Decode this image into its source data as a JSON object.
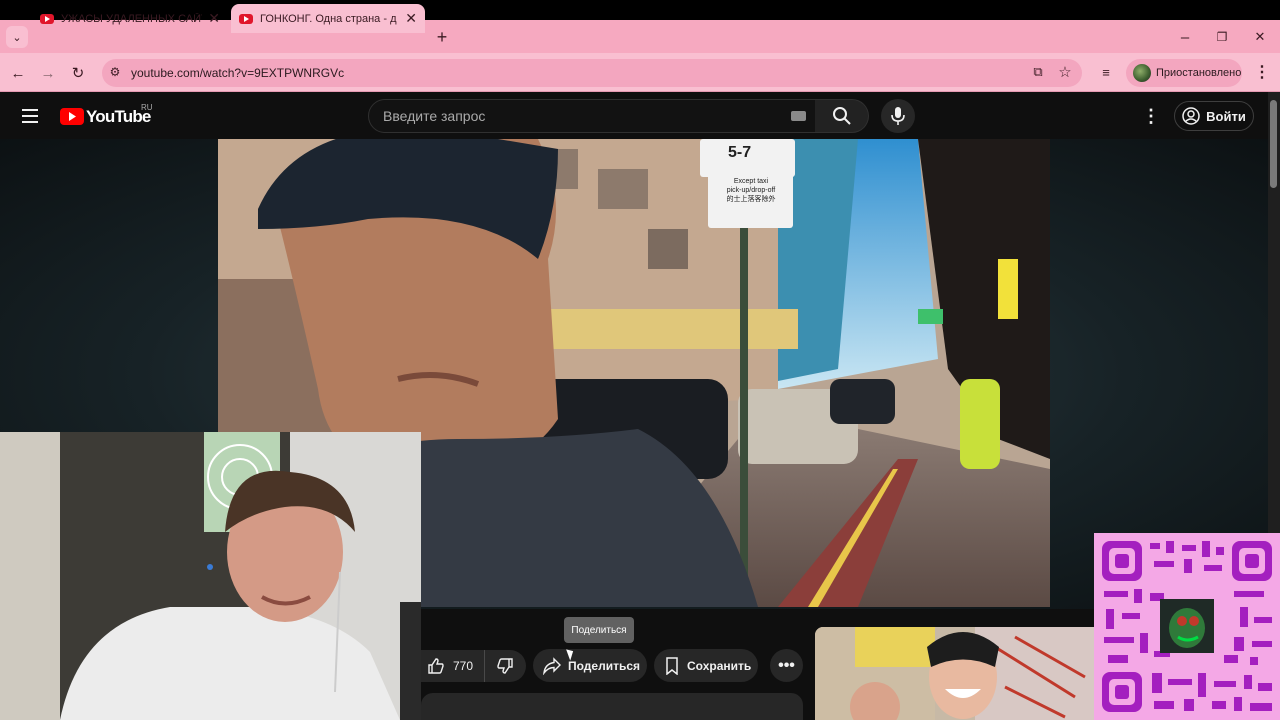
{
  "browser": {
    "tabs": [
      {
        "title": "УЖАСЫ УДАЛЕННЫХ САЙТОВ",
        "active": false
      },
      {
        "title": "ГОНКОНГ. Одна страна - д",
        "active": true
      }
    ],
    "new_tab_label": "+",
    "url": "youtube.com/watch?v=9EXTPWNRGVc",
    "profile_status": "Приостановлено",
    "accent_color": "#f6a9c0"
  },
  "youtube": {
    "logo_text": "YouTube",
    "region": "RU",
    "search_placeholder": "Введите запрос",
    "login_label": "Войти",
    "video": {
      "sign_number": "5-7",
      "sign_lines": [
        "Except taxi",
        "pick-up/drop-off",
        "的士上落客除外"
      ]
    },
    "actions": {
      "likes": "770",
      "share_label": "Поделиться",
      "save_label": "Сохранить",
      "tooltip": "Поделиться"
    }
  }
}
